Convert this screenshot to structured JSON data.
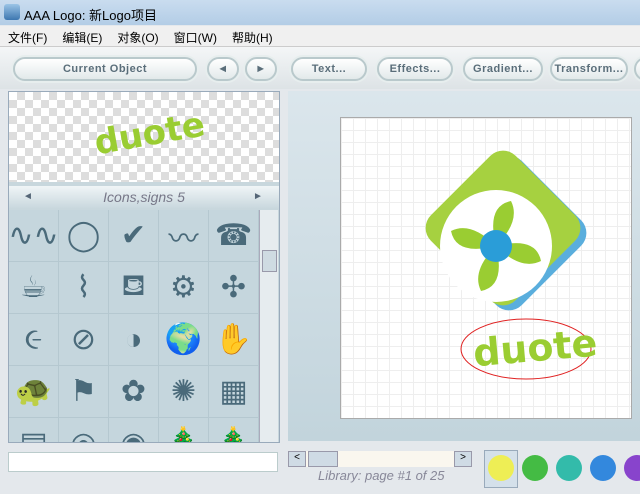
{
  "window": {
    "title": "AAA Logo: 新Logo项目"
  },
  "menu": [
    "文件(F)",
    "编辑(E)",
    "对象(O)",
    "窗口(W)",
    "帮助(H)"
  ],
  "toolbar": {
    "current_object": "Current Object",
    "prev": "◄",
    "next": "►",
    "text": "Text...",
    "effects": "Effects...",
    "gradient": "Gradient...",
    "transform": "Transform..."
  },
  "preview": {
    "text": "duote"
  },
  "library": {
    "category": "Icons,signs 5",
    "prev": "◄",
    "next": "►",
    "status": "Library: page #1 of 25",
    "icons": [
      "∿∿",
      "◯",
      "✔",
      "〰",
      "☎",
      "☕",
      "⌇",
      "⛾",
      "⚙",
      "✣",
      "૯",
      "⊘",
      "◑",
      "🌍",
      "✋",
      "🐢",
      "⚑",
      "✿",
      "✺",
      "▦",
      "▤",
      "◎",
      "◉",
      "🎄",
      "🎄"
    ]
  },
  "canvas": {
    "logo_text": "duote"
  },
  "colors": {
    "accent": "#9acd32",
    "ellipse": "#e02020",
    "swatches": [
      "#eeee55",
      "#44bb44",
      "#33bbaa",
      "#3388dd",
      "#8844cc"
    ]
  }
}
